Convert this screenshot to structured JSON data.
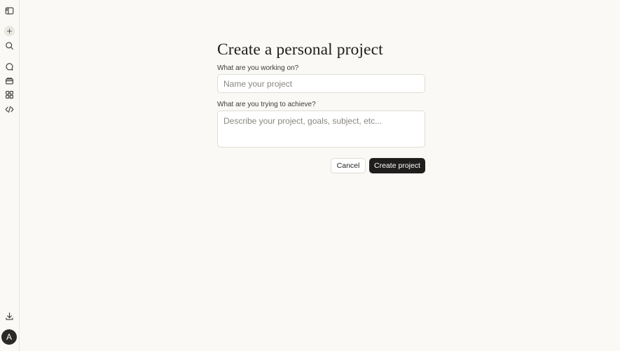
{
  "sidebar": {
    "icons": [
      "sidebar-toggle-icon",
      "plus-icon",
      "search-icon",
      "chats-icon",
      "projects-icon",
      "artifacts-icon",
      "code-icon",
      "download-icon"
    ],
    "avatar_initial": "A"
  },
  "form": {
    "title": "Create a personal project",
    "name_label": "What are you working on?",
    "name_placeholder": "Name your project",
    "goal_label": "What are you trying to achieve?",
    "goal_placeholder": "Describe your project, goals, subject, etc...",
    "cancel_label": "Cancel",
    "create_label": "Create project"
  },
  "colors": {
    "background": "#faf9f5",
    "primary_button": "#1f1e1d",
    "border": "#dedcd3"
  }
}
